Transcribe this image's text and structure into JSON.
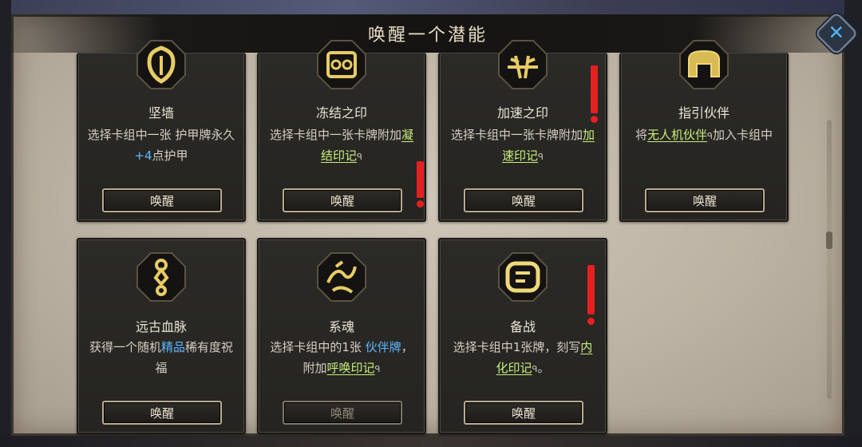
{
  "dialog": {
    "title": "唤醒一个潜能",
    "close_label": "✕"
  },
  "colors": {
    "keyword_blue": "#5db7ff",
    "keyword_green": "#c8ef7a",
    "alert_red": "#e42020",
    "icon_gold": "#e8cc64"
  },
  "cards": [
    {
      "title": "坚墙",
      "icon": "wall-shield-icon",
      "desc_parts": [
        {
          "t": "选择卡组中一张 "
        },
        {
          "t": "护甲牌",
          "s": "normal"
        },
        {
          "t": "永久"
        },
        {
          "t": "+4",
          "s": "blue"
        },
        {
          "t": "点护甲"
        }
      ],
      "button": "唤醒",
      "enabled": true,
      "alert": false
    },
    {
      "title": "冻结之印",
      "icon": "freeze-seal-icon",
      "desc_parts": [
        {
          "t": "选择卡组中一张卡牌附加"
        },
        {
          "t": "凝结印记",
          "s": "green"
        },
        {
          "t": "ᑫ",
          "s": "tip"
        }
      ],
      "button": "唤醒",
      "enabled": true,
      "alert": true
    },
    {
      "title": "加速之印",
      "icon": "haste-seal-icon",
      "desc_parts": [
        {
          "t": "选择卡组中一张卡牌附加"
        },
        {
          "t": "加速印记",
          "s": "green"
        },
        {
          "t": "ᑫ",
          "s": "tip"
        }
      ],
      "button": "唤醒",
      "enabled": true,
      "alert": true
    },
    {
      "title": "指引伙伴",
      "icon": "guide-companion-icon",
      "desc_parts": [
        {
          "t": "将"
        },
        {
          "t": "无人机伙伴",
          "s": "green"
        },
        {
          "t": "ᑫ",
          "s": "tip"
        },
        {
          "t": "加入卡组中"
        }
      ],
      "button": "唤醒",
      "enabled": true,
      "alert": false
    },
    {
      "title": "远古血脉",
      "icon": "ancient-bloodline-icon",
      "desc_parts": [
        {
          "t": "获得一个随机"
        },
        {
          "t": "精品",
          "s": "blue"
        },
        {
          "t": "稀有度祝福"
        }
      ],
      "button": "唤醒",
      "enabled": true,
      "alert": false
    },
    {
      "title": "系魂",
      "icon": "soul-bind-icon",
      "desc_parts": [
        {
          "t": "选择卡组中的1张 "
        },
        {
          "t": "伙伴牌",
          "s": "blue"
        },
        {
          "t": "，附加"
        },
        {
          "t": "呼唤印记",
          "s": "green"
        },
        {
          "t": "ᑫ",
          "s": "tip"
        }
      ],
      "button": "唤醒",
      "enabled": false,
      "alert": false
    },
    {
      "title": "备战",
      "icon": "prepare-battle-icon",
      "desc_parts": [
        {
          "t": "选择卡组中1张牌，刻写"
        },
        {
          "t": "内化印记",
          "s": "green"
        },
        {
          "t": "ᑫ",
          "s": "tip"
        },
        {
          "t": "。"
        }
      ],
      "button": "唤醒",
      "enabled": true,
      "alert": true
    }
  ]
}
